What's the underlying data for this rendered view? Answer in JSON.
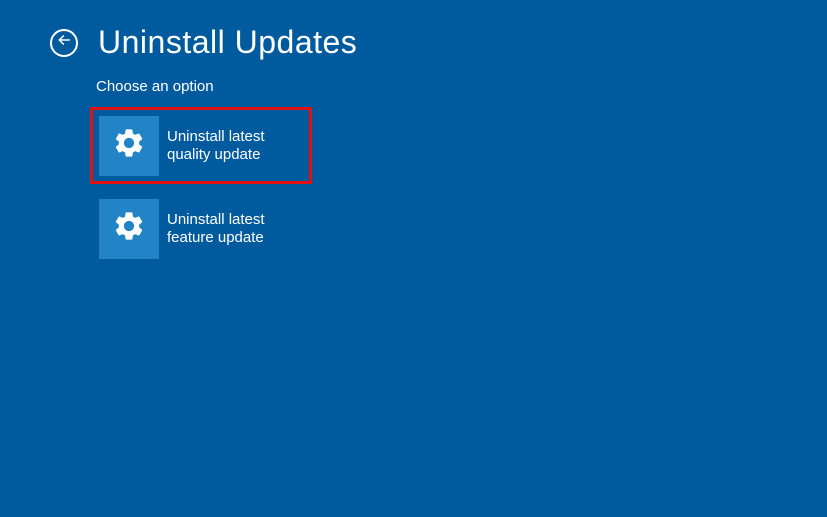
{
  "header": {
    "title": "Uninstall Updates"
  },
  "subtitle": "Choose an option",
  "options": [
    {
      "label": "Uninstall latest quality update",
      "highlighted": true
    },
    {
      "label": "Uninstall latest feature update",
      "highlighted": false
    }
  ]
}
